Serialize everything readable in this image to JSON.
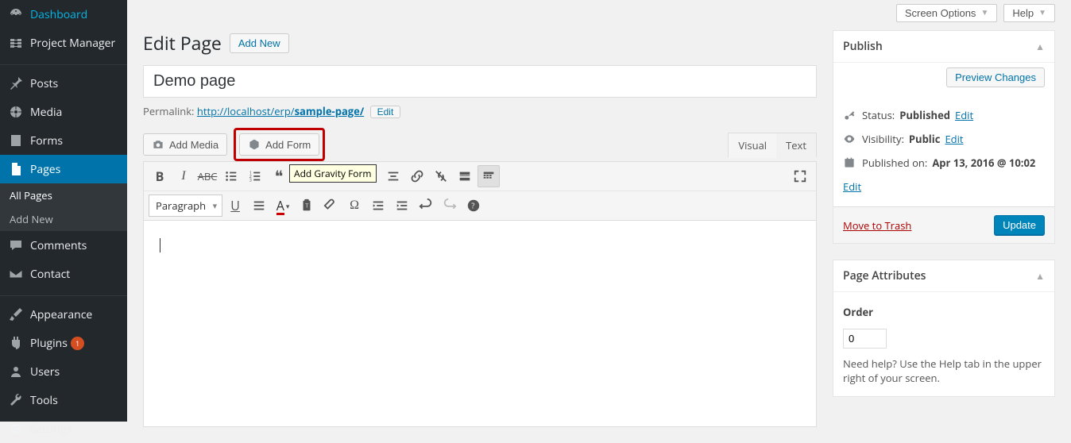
{
  "topActions": {
    "screenOptions": "Screen Options",
    "help": "Help"
  },
  "sidebar": {
    "items": [
      {
        "label": "Dashboard"
      },
      {
        "label": "Project Manager"
      },
      {
        "label": "Posts"
      },
      {
        "label": "Media"
      },
      {
        "label": "Forms"
      },
      {
        "label": "Pages"
      },
      {
        "label": "Comments"
      },
      {
        "label": "Contact"
      },
      {
        "label": "Appearance"
      },
      {
        "label": "Plugins",
        "badge": "1"
      },
      {
        "label": "Users"
      },
      {
        "label": "Tools"
      },
      {
        "label": "Settings"
      }
    ],
    "sub": {
      "all": "All Pages",
      "new": "Add New"
    }
  },
  "page": {
    "heading": "Edit Page",
    "addNew": "Add New",
    "title": "Demo page",
    "permalinkLabel": "Permalink:",
    "permalinkBase": "http://localhost/erp/",
    "permalinkSlug": "sample-page/",
    "editBtn": "Edit"
  },
  "editor": {
    "addMedia": "Add Media",
    "addForm": "Add Form",
    "tooltip": "Add Gravity Form",
    "tabs": {
      "visual": "Visual",
      "text": "Text"
    },
    "formatSelect": "Paragraph"
  },
  "publish": {
    "title": "Publish",
    "preview": "Preview Changes",
    "statusLabel": "Status:",
    "statusValue": "Published",
    "visibilityLabel": "Visibility:",
    "visibilityValue": "Public",
    "publishedLabel": "Published on:",
    "publishedValue": "Apr 13, 2016 @ 10:02",
    "edit": "Edit",
    "trash": "Move to Trash",
    "update": "Update"
  },
  "attributes": {
    "title": "Page Attributes",
    "orderLabel": "Order",
    "orderValue": "0",
    "help": "Need help? Use the Help tab in the upper right of your screen."
  }
}
